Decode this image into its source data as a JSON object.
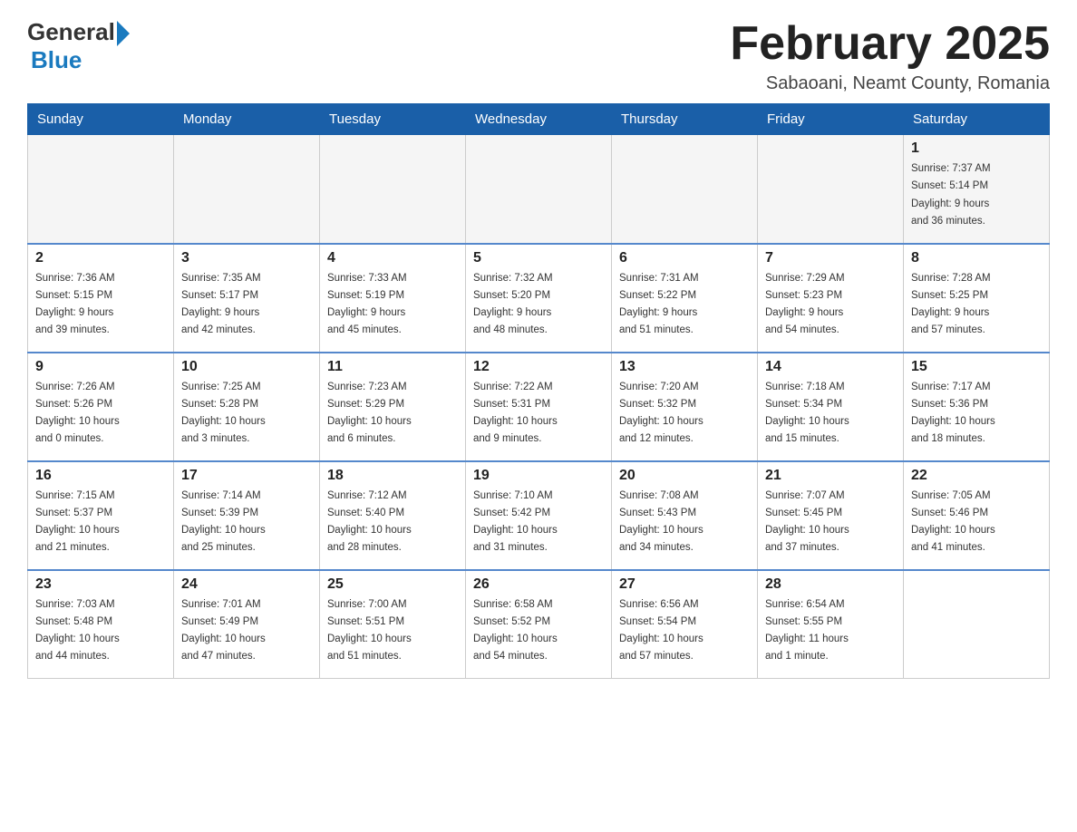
{
  "header": {
    "logo_general": "General",
    "logo_blue": "Blue",
    "month_title": "February 2025",
    "subtitle": "Sabaoani, Neamt County, Romania"
  },
  "weekdays": [
    "Sunday",
    "Monday",
    "Tuesday",
    "Wednesday",
    "Thursday",
    "Friday",
    "Saturday"
  ],
  "weeks": [
    [
      {
        "day": "",
        "info": ""
      },
      {
        "day": "",
        "info": ""
      },
      {
        "day": "",
        "info": ""
      },
      {
        "day": "",
        "info": ""
      },
      {
        "day": "",
        "info": ""
      },
      {
        "day": "",
        "info": ""
      },
      {
        "day": "1",
        "info": "Sunrise: 7:37 AM\nSunset: 5:14 PM\nDaylight: 9 hours\nand 36 minutes."
      }
    ],
    [
      {
        "day": "2",
        "info": "Sunrise: 7:36 AM\nSunset: 5:15 PM\nDaylight: 9 hours\nand 39 minutes."
      },
      {
        "day": "3",
        "info": "Sunrise: 7:35 AM\nSunset: 5:17 PM\nDaylight: 9 hours\nand 42 minutes."
      },
      {
        "day": "4",
        "info": "Sunrise: 7:33 AM\nSunset: 5:19 PM\nDaylight: 9 hours\nand 45 minutes."
      },
      {
        "day": "5",
        "info": "Sunrise: 7:32 AM\nSunset: 5:20 PM\nDaylight: 9 hours\nand 48 minutes."
      },
      {
        "day": "6",
        "info": "Sunrise: 7:31 AM\nSunset: 5:22 PM\nDaylight: 9 hours\nand 51 minutes."
      },
      {
        "day": "7",
        "info": "Sunrise: 7:29 AM\nSunset: 5:23 PM\nDaylight: 9 hours\nand 54 minutes."
      },
      {
        "day": "8",
        "info": "Sunrise: 7:28 AM\nSunset: 5:25 PM\nDaylight: 9 hours\nand 57 minutes."
      }
    ],
    [
      {
        "day": "9",
        "info": "Sunrise: 7:26 AM\nSunset: 5:26 PM\nDaylight: 10 hours\nand 0 minutes."
      },
      {
        "day": "10",
        "info": "Sunrise: 7:25 AM\nSunset: 5:28 PM\nDaylight: 10 hours\nand 3 minutes."
      },
      {
        "day": "11",
        "info": "Sunrise: 7:23 AM\nSunset: 5:29 PM\nDaylight: 10 hours\nand 6 minutes."
      },
      {
        "day": "12",
        "info": "Sunrise: 7:22 AM\nSunset: 5:31 PM\nDaylight: 10 hours\nand 9 minutes."
      },
      {
        "day": "13",
        "info": "Sunrise: 7:20 AM\nSunset: 5:32 PM\nDaylight: 10 hours\nand 12 minutes."
      },
      {
        "day": "14",
        "info": "Sunrise: 7:18 AM\nSunset: 5:34 PM\nDaylight: 10 hours\nand 15 minutes."
      },
      {
        "day": "15",
        "info": "Sunrise: 7:17 AM\nSunset: 5:36 PM\nDaylight: 10 hours\nand 18 minutes."
      }
    ],
    [
      {
        "day": "16",
        "info": "Sunrise: 7:15 AM\nSunset: 5:37 PM\nDaylight: 10 hours\nand 21 minutes."
      },
      {
        "day": "17",
        "info": "Sunrise: 7:14 AM\nSunset: 5:39 PM\nDaylight: 10 hours\nand 25 minutes."
      },
      {
        "day": "18",
        "info": "Sunrise: 7:12 AM\nSunset: 5:40 PM\nDaylight: 10 hours\nand 28 minutes."
      },
      {
        "day": "19",
        "info": "Sunrise: 7:10 AM\nSunset: 5:42 PM\nDaylight: 10 hours\nand 31 minutes."
      },
      {
        "day": "20",
        "info": "Sunrise: 7:08 AM\nSunset: 5:43 PM\nDaylight: 10 hours\nand 34 minutes."
      },
      {
        "day": "21",
        "info": "Sunrise: 7:07 AM\nSunset: 5:45 PM\nDaylight: 10 hours\nand 37 minutes."
      },
      {
        "day": "22",
        "info": "Sunrise: 7:05 AM\nSunset: 5:46 PM\nDaylight: 10 hours\nand 41 minutes."
      }
    ],
    [
      {
        "day": "23",
        "info": "Sunrise: 7:03 AM\nSunset: 5:48 PM\nDaylight: 10 hours\nand 44 minutes."
      },
      {
        "day": "24",
        "info": "Sunrise: 7:01 AM\nSunset: 5:49 PM\nDaylight: 10 hours\nand 47 minutes."
      },
      {
        "day": "25",
        "info": "Sunrise: 7:00 AM\nSunset: 5:51 PM\nDaylight: 10 hours\nand 51 minutes."
      },
      {
        "day": "26",
        "info": "Sunrise: 6:58 AM\nSunset: 5:52 PM\nDaylight: 10 hours\nand 54 minutes."
      },
      {
        "day": "27",
        "info": "Sunrise: 6:56 AM\nSunset: 5:54 PM\nDaylight: 10 hours\nand 57 minutes."
      },
      {
        "day": "28",
        "info": "Sunrise: 6:54 AM\nSunset: 5:55 PM\nDaylight: 11 hours\nand 1 minute."
      },
      {
        "day": "",
        "info": ""
      }
    ]
  ]
}
